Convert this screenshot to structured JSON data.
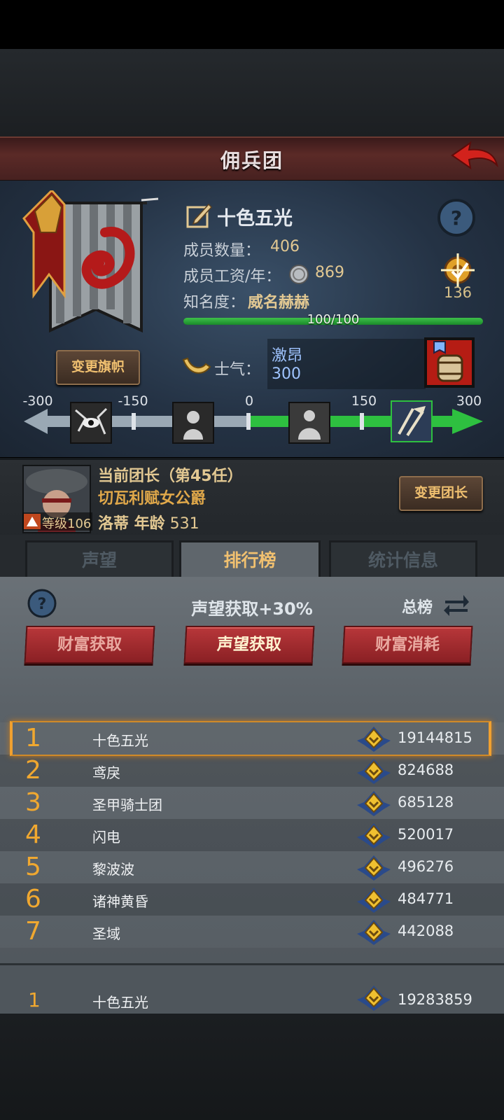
{
  "header": {
    "title": "佣兵团"
  },
  "team": {
    "name": "十色五光",
    "member_count_label": "成员数量：",
    "member_count": "406",
    "salary_label": "成员工资/年：",
    "salary": "869",
    "fame_label": "知名度：",
    "fame_word": "威名赫赫",
    "fame_progress_text": "100/100",
    "fame_progress": 1.0,
    "rank_badge_count": "136",
    "change_flag_label": "变更旗帜"
  },
  "morale": {
    "label": "士气：",
    "word": "激昂",
    "value": "300",
    "scale": [
      "-300",
      "-150",
      "0",
      "150",
      "300"
    ],
    "current": 300
  },
  "leader": {
    "line1": "当前团长（第45任）",
    "title": "切瓦利赋女公爵",
    "name_age": "洛蒂  年龄",
    "age": "531",
    "level_label": "等级106",
    "change_label": "变更团长"
  },
  "tabs": [
    {
      "label": "声望",
      "active": false
    },
    {
      "label": "排行榜",
      "active": true
    },
    {
      "label": "统计信息",
      "active": false
    }
  ],
  "ranking": {
    "title": "声望获取+30%",
    "total_label": "总榜",
    "buttons": [
      "财富获取",
      "声望获取",
      "财富消耗"
    ],
    "rows": [
      {
        "rank": "1",
        "name": "十色五光",
        "score": "19144815"
      },
      {
        "rank": "2",
        "name": "鸢戾",
        "score": "824688"
      },
      {
        "rank": "3",
        "name": "圣甲骑士团",
        "score": "685128"
      },
      {
        "rank": "4",
        "name": "闪电",
        "score": "520017"
      },
      {
        "rank": "5",
        "name": "黎波波",
        "score": "496276"
      },
      {
        "rank": "6",
        "name": "诸神黄昏",
        "score": "484771"
      },
      {
        "rank": "7",
        "name": "圣域",
        "score": "442088"
      }
    ],
    "my_row": {
      "rank": "1",
      "name": "十色五光",
      "score": "19283859"
    }
  },
  "colors": {
    "accent_gold": "#e2c892",
    "button_red": "#b8373a",
    "morale_blue": "#9fc4ff",
    "progress_green": "#3ec04a"
  }
}
